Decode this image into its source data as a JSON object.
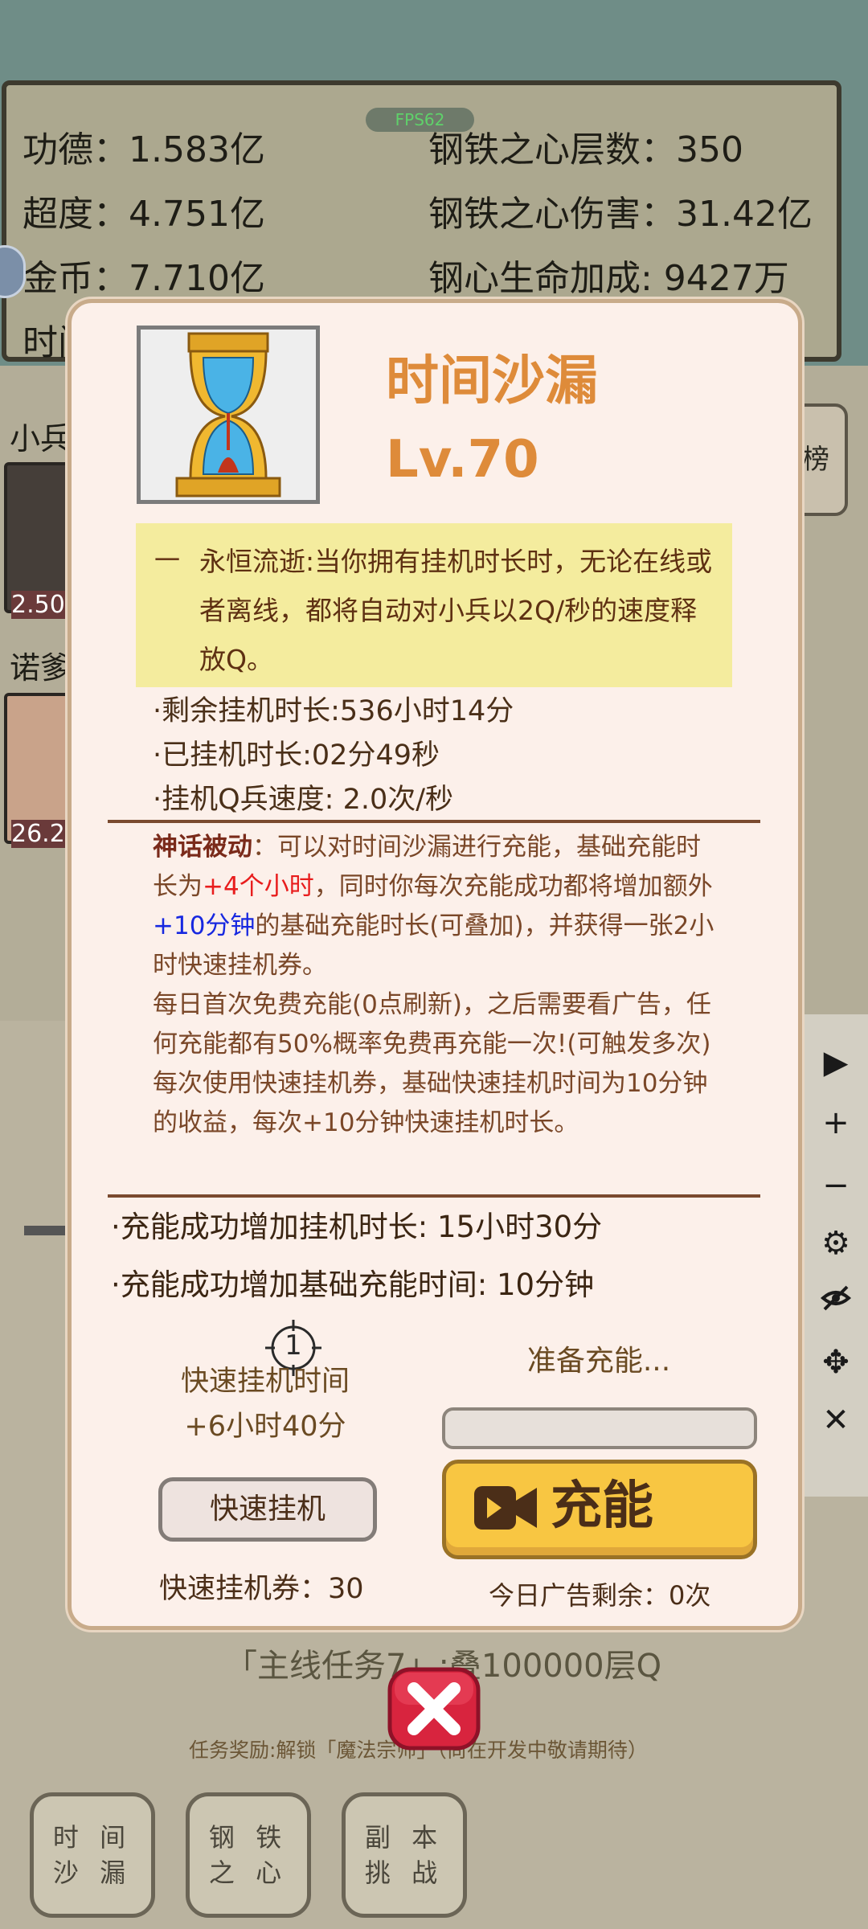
{
  "fps": "FPS62",
  "stats": {
    "merit": "功德：1.583亿",
    "salvation": "超度：4.751亿",
    "coins": "金币：7.710亿",
    "time_partial": "时间",
    "steel_layers": "钢铁之心层数：350",
    "steel_damage": "钢铁之心伤害：31.42亿",
    "steel_hp_bonus": "钢心生命加成: 9427万"
  },
  "background": {
    "minion_label": "小兵",
    "nuo_label": "诺爹",
    "card1_value": "2.50",
    "card2_value": "26.2",
    "rank_button": "榜",
    "mainline_task": "「主线任务7」:叠100000层Q",
    "task_reward": "任务奖励:解锁「魔法宗师」（尚在开发中敬请期待）"
  },
  "bottom_nav": [
    {
      "label": "时 间\n沙 漏"
    },
    {
      "label": "钢 铁\n之 心"
    },
    {
      "label": "副 本\n挑 战"
    }
  ],
  "modal": {
    "item_name": "时间沙漏",
    "item_level": "Lv.70",
    "effect_dash": "一",
    "effect_desc": "永恒流逝:当你拥有挂机时长时，无论在线或者离线，都将自动对小兵以2Q/秒的速度释放Q。",
    "info": {
      "remaining": "·剩余挂机时长:536小时14分",
      "elapsed": "·已挂机时长:02分49秒",
      "speed": "·挂机Q兵速度: 2.0次/秒"
    },
    "myth": {
      "title": "神话被动",
      "p1_a": "：可以对时间沙漏进行充能，基础充能时长为",
      "p1_red": "+4个小时",
      "p1_b": "，同时你每次充能成功都将增加额外",
      "p1_blue": "+10分钟",
      "p1_c": "的基础充能时长(可叠加)，并获得一张2小时快速挂机券。",
      "p2": "每日首次免费充能(0点刷新)，之后需要看广告，任何充能都有50%概率免费再充能一次!(可触发多次)",
      "p3": "每次使用快速挂机券，基础快速挂机时间为10分钟的收益，每次+10分钟快速挂机时长。"
    },
    "charge_gain": "·充能成功增加挂机时长: 15小时30分",
    "charge_base": "·充能成功增加基础充能时间: 10分钟",
    "counter": "1",
    "quick_time_label": "快速挂机时间",
    "quick_time_value": "+6小时40分",
    "prep_label": "准备充能...",
    "progress_fraction": 0,
    "quick_button": "快速挂机",
    "charge_button": "充能",
    "ticket_label": "快速挂机券：30",
    "ad_label": "今日广告剩余：0次"
  },
  "colors": {
    "accent_orange": "#de8b3a",
    "highlight_red": "#e81d1d",
    "highlight_blue": "#1728e0",
    "charge_yellow": "#f8c642"
  },
  "icons": {
    "toolbar": [
      "play-icon",
      "plus-icon",
      "minus-icon",
      "gear-icon",
      "eye-slash-icon",
      "move-icon",
      "close-icon"
    ],
    "charge": "video-camera-icon",
    "close": "close-icon"
  }
}
